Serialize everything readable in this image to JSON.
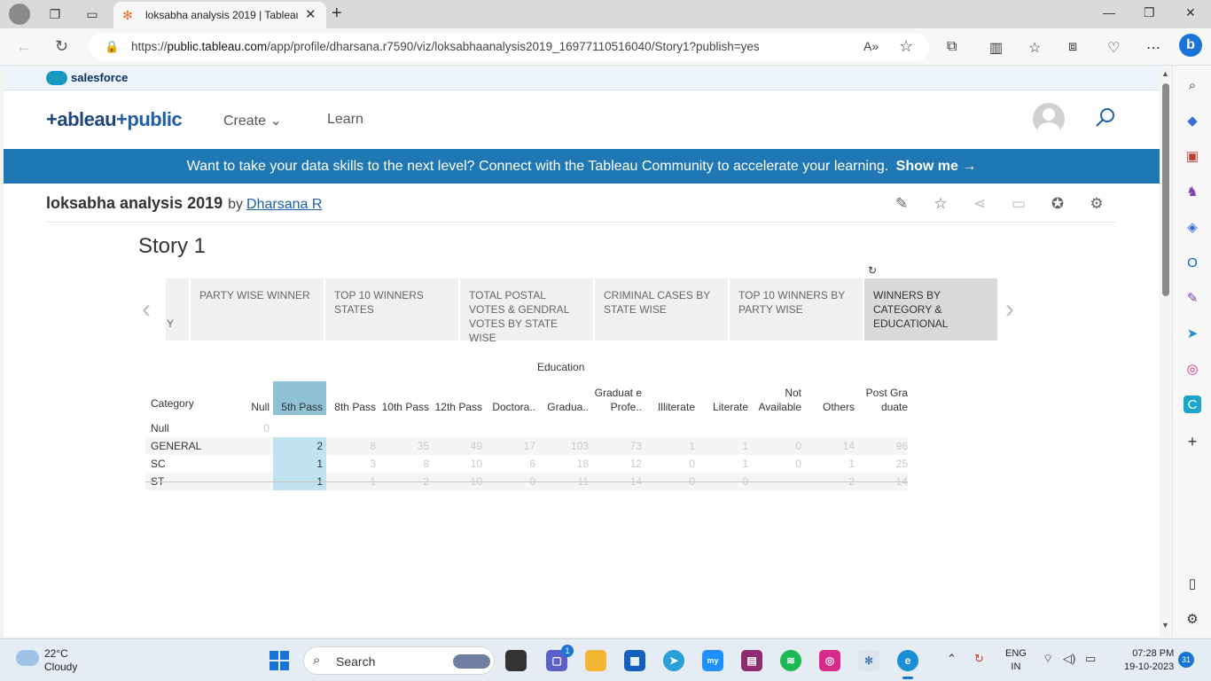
{
  "browser": {
    "tab_title": "loksabha analysis 2019 | Tableau",
    "url_prefix": "https://",
    "url_host": "public.tableau.com",
    "url_path": "/app/profile/dharsana.r7590/viz/loksabhaanalysis2019_16977110516040/Story1?publish=yes"
  },
  "salesforce": {
    "label": "salesforce"
  },
  "header": {
    "logo_main": "+ableau",
    "logo_accent": "+public",
    "nav_create": "Create",
    "nav_learn": "Learn"
  },
  "banner": {
    "text": "Want to take your data skills to the next level? Connect with the Tableau Community to accelerate your learning.",
    "cta": "Show me →"
  },
  "viz": {
    "title": "loksabha analysis 2019",
    "by": "by",
    "author": "Dharsana R"
  },
  "story": {
    "title": "Story 1",
    "points": [
      "Y",
      "PARTY WISE WINNER",
      "TOP 10 WINNERS STATES",
      "TOTAL POSTAL VOTES & GENDRAL VOTES BY STATE WISE",
      "CRIMINAL CASES BY STATE WISE",
      "TOP 10 WINNERS BY PARTY WISE",
      "WINNERS BY CATEGORY & EDUCATIONAL"
    ],
    "active_index": 6
  },
  "table": {
    "group_title": "Education",
    "category_header": "Category",
    "columns": [
      "Null",
      "5th Pass",
      "8th Pass",
      "10th Pass",
      "12th Pass",
      "Doctora..",
      "Gradua..",
      "Graduat e Profe..",
      "Illiterate",
      "Literate",
      "Not Available",
      "Others",
      "Post Gra duate"
    ],
    "selected_column": 1,
    "rows": [
      {
        "category": "Null",
        "values": [
          "0",
          "",
          "",
          "",
          "",
          "",
          "",
          "",
          "",
          "",
          "",
          "",
          ""
        ]
      },
      {
        "category": "GENERAL",
        "values": [
          "",
          "2",
          "8",
          "35",
          "49",
          "17",
          "103",
          "73",
          "1",
          "1",
          "0",
          "14",
          "96"
        ]
      },
      {
        "category": "SC",
        "values": [
          "",
          "1",
          "3",
          "8",
          "10",
          "6",
          "18",
          "12",
          "0",
          "1",
          "0",
          "1",
          "25"
        ]
      },
      {
        "category": "ST",
        "values": [
          "",
          "1",
          "1",
          "2",
          "10",
          "0",
          "11",
          "14",
          "0",
          "0",
          "",
          "2",
          "14"
        ]
      }
    ]
  },
  "taskbar": {
    "temperature": "22°C",
    "weather": "Cloudy",
    "search_placeholder": "Search",
    "chat_badge": "1",
    "lang_top": "ENG",
    "lang_bottom": "IN",
    "time": "07:28 PM",
    "date": "19-10-2023",
    "notif_count": "31"
  },
  "colors": {
    "accent_blue": "#1f77b4",
    "tableau_orange": "#e97627",
    "selected_header": "#8fc1d5",
    "selected_cell": "#bfe3f1"
  }
}
